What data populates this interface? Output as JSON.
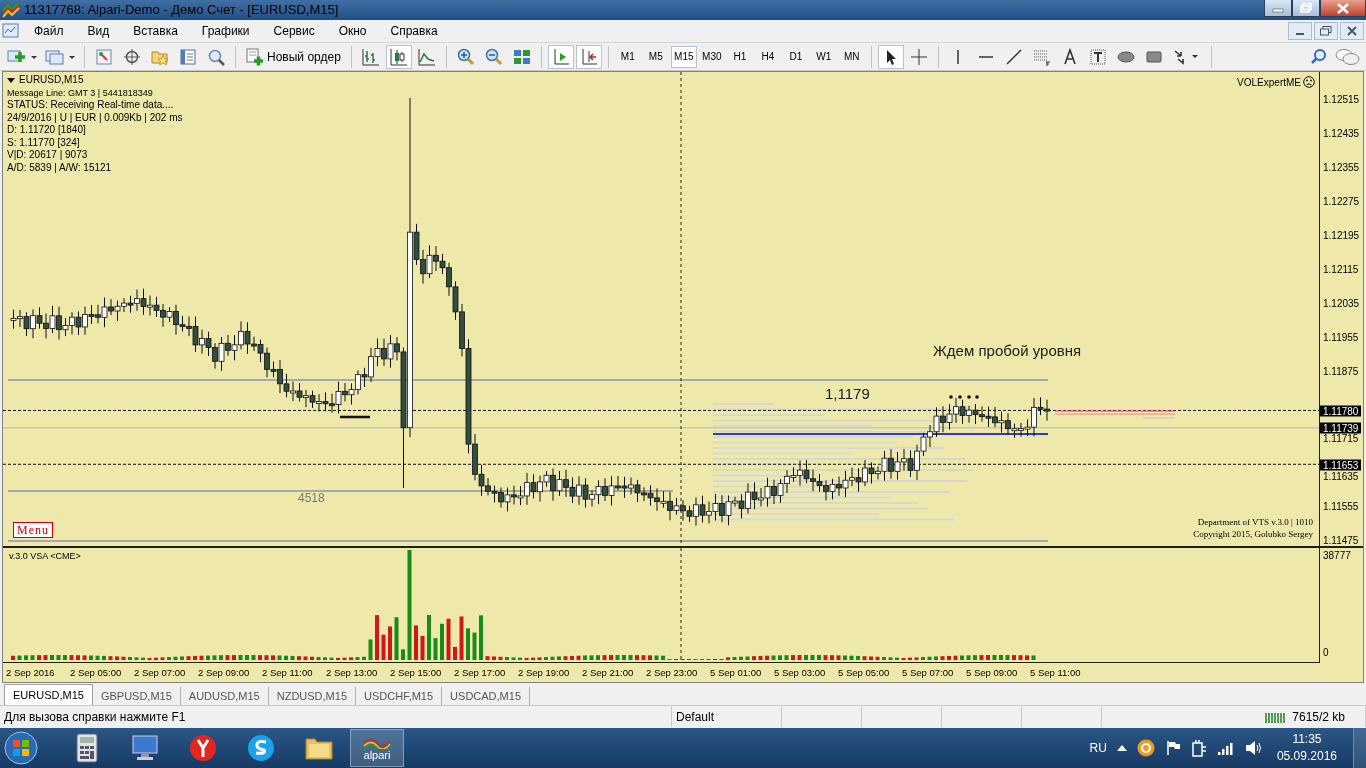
{
  "window": {
    "title": "11317768: Alpari-Demo - Демо Счет - [EURUSD,M15]"
  },
  "menu": [
    "Файл",
    "Вид",
    "Вставка",
    "Графики",
    "Сервис",
    "Окно",
    "Справка"
  ],
  "toolbar": {
    "new_order": "Новый ордер",
    "chart_types": [
      {
        "kind": "bars",
        "selected": false
      },
      {
        "kind": "candles",
        "selected": true
      },
      {
        "kind": "line",
        "selected": false
      }
    ],
    "timeframes": [
      {
        "label": "M1",
        "selected": false
      },
      {
        "label": "M5",
        "selected": false
      },
      {
        "label": "M15",
        "selected": true
      },
      {
        "label": "M30",
        "selected": false
      },
      {
        "label": "H1",
        "selected": false
      },
      {
        "label": "H4",
        "selected": false
      },
      {
        "label": "D1",
        "selected": false
      },
      {
        "label": "W1",
        "selected": false
      },
      {
        "label": "MN",
        "selected": false
      }
    ]
  },
  "chart": {
    "symbol": "EURUSD,M15",
    "info_lines": [
      "Message Line: GMT 3 | 5441818349",
      "STATUS:  Receiving Real-time data....",
      "24/9/2016 | U | EUR | 0.009Kb | 202 ms",
      "D: 1.11720  [1840]",
      "S: 1.11770  [324]",
      "V|D: 20617 | 9073",
      "A/D: 5839 | A/W: 15121"
    ],
    "expert": "VOLExpertME",
    "annotation": "Ждем пробой уровня",
    "level_label": "1,1179",
    "count_label": "4518",
    "menu_button": "Menu",
    "credits": [
      "Department of VTS  v.3.0 | 1010",
      "Copyright 2015, Golubko Sergey"
    ],
    "price_ticks": [
      "1.12515",
      "1.12435",
      "1.12355",
      "1.12275",
      "1.12195",
      "1.12115",
      "1.12035",
      "1.11955",
      "1.11875",
      "1.11715",
      "1.11635",
      "1.11555",
      "1.11475"
    ],
    "price_marks": [
      "1.11780",
      "1.11739",
      "1.11653"
    ]
  },
  "indicator": {
    "title": "v.3.0 VSA <CME>",
    "scale_max": "38777",
    "scale_min": "0"
  },
  "time_axis": [
    "2 Sep 2016",
    "2 Sep 05:00",
    "2 Sep 07:00",
    "2 Sep 09:00",
    "2 Sep 11:00",
    "2 Sep 13:00",
    "2 Sep 15:00",
    "2 Sep 17:00",
    "2 Sep 19:00",
    "2 Sep 21:00",
    "2 Sep 23:00",
    "5 Sep 01:00",
    "5 Sep 03:00",
    "5 Sep 05:00",
    "5 Sep 07:00",
    "5 Sep 09:00",
    "5 Sep 11:00"
  ],
  "tabs": [
    {
      "label": "EURUSD,M15",
      "selected": true
    },
    {
      "label": "GBPUSD,M15",
      "selected": false
    },
    {
      "label": "AUDUSD,M15",
      "selected": false
    },
    {
      "label": "NZDUSD,M15",
      "selected": false
    },
    {
      "label": "USDCHF,M15",
      "selected": false
    },
    {
      "label": "USDCAD,M15",
      "selected": false
    }
  ],
  "status_bar": {
    "help": "Для вызова справки нажмите F1",
    "profile": "Default",
    "traffic": "7615/2 kb"
  },
  "taskbar": {
    "app_label": "alpari",
    "language": "RU",
    "time": "11:35",
    "date": "05.09.2016"
  }
}
